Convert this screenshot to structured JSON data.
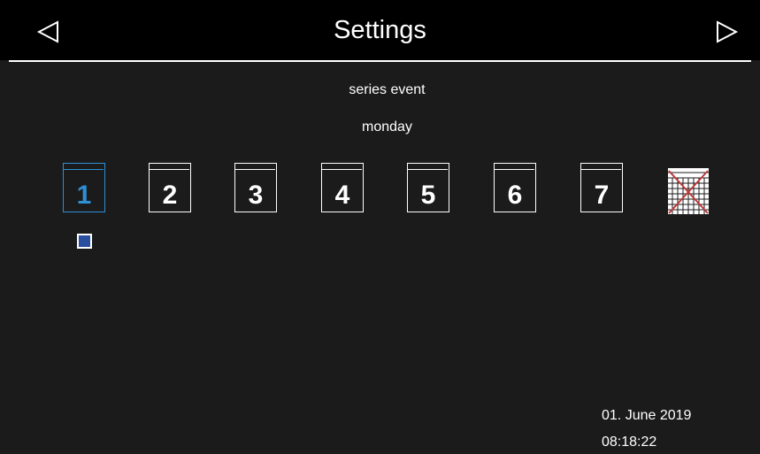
{
  "header": {
    "title": "Settings",
    "prev_icon": "triangle-left-icon",
    "next_icon": "triangle-right-icon"
  },
  "main": {
    "event_label": "series event",
    "day_label": "monday",
    "days": [
      {
        "label": "1",
        "selected": true
      },
      {
        "label": "2",
        "selected": false
      },
      {
        "label": "3",
        "selected": false
      },
      {
        "label": "4",
        "selected": false
      },
      {
        "label": "5",
        "selected": false
      },
      {
        "label": "6",
        "selected": false
      },
      {
        "label": "7",
        "selected": false
      }
    ],
    "calendar_icon": "calendar-crossed-icon"
  },
  "footer": {
    "date": "01. June 2019",
    "time": "08:18:22"
  },
  "colors": {
    "background": "#1b1b1b",
    "header_background": "#000000",
    "accent": "#2f8fd4",
    "indicator_fill": "#2a4f9e",
    "cross": "#c0393b"
  }
}
